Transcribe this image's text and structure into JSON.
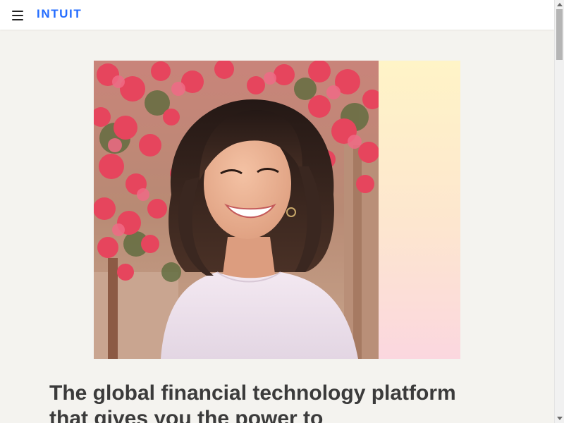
{
  "header": {
    "brand": "INTUIT",
    "brand_color": "#236cff"
  },
  "hero": {
    "image_alt": "Smiling woman with dark shoulder-length hair in a white top standing in front of pink bougainvillea flowers",
    "gradient_colors": [
      "#fff4c7",
      "#fbd7df"
    ]
  },
  "main": {
    "headline": "The global financial technology platform that gives you the power to"
  }
}
